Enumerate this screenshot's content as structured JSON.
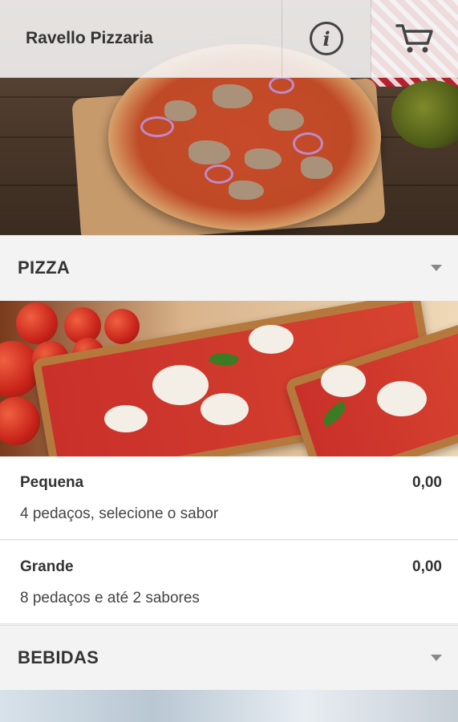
{
  "app": {
    "title": "Ravello Pizzaria"
  },
  "icons": {
    "info": "info-icon",
    "cart": "cart-icon",
    "chevron": "chevron-down-icon"
  },
  "sections": [
    {
      "title": "PIZZA",
      "items": [
        {
          "name": "Pequena",
          "price": "0,00",
          "description": "4 pedaços, selecione o sabor"
        },
        {
          "name": "Grande",
          "price": "0,00",
          "description": "8 pedaços e até 2 sabores"
        }
      ]
    },
    {
      "title": "BEBIDAS"
    }
  ],
  "colors": {
    "background": "#f3f3f3",
    "text": "#333333",
    "card": "#ffffff"
  }
}
